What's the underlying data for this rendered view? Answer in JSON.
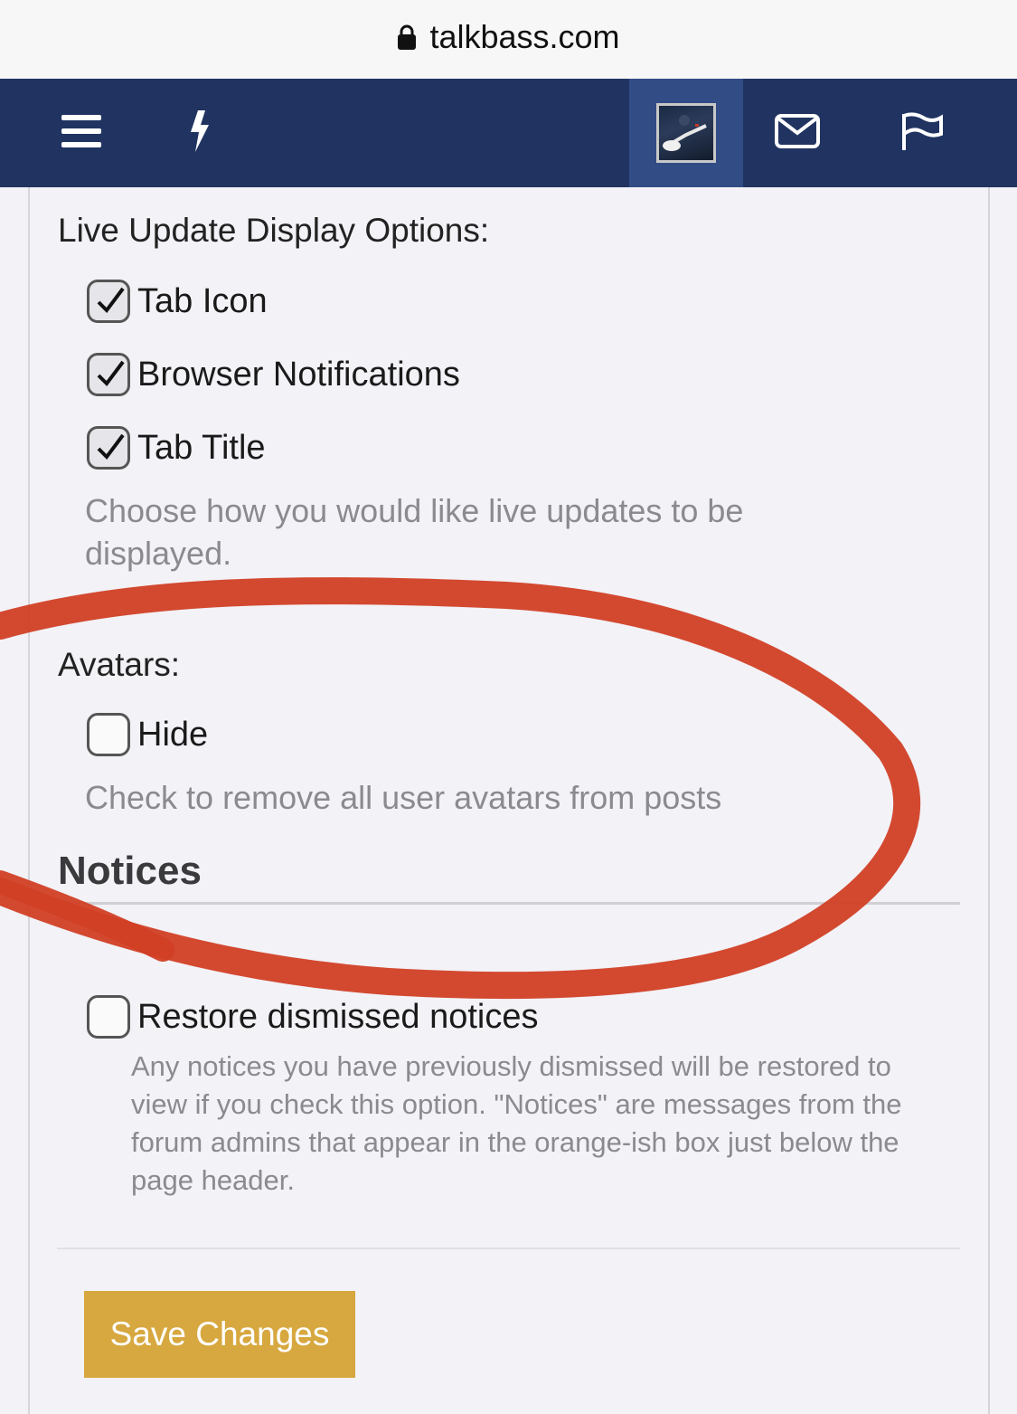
{
  "browser": {
    "url": "talkbass.com"
  },
  "header": {
    "icons": [
      "menu-icon",
      "lightning-icon",
      "avatar",
      "envelope-icon",
      "flag-icon"
    ]
  },
  "live_update": {
    "label": "Live Update Display Options:",
    "options": [
      {
        "label": "Tab Icon",
        "checked": true
      },
      {
        "label": "Browser Notifications",
        "checked": true
      },
      {
        "label": "Tab Title",
        "checked": true
      }
    ],
    "hint": "Choose how you would like live updates to be displayed."
  },
  "avatars": {
    "label": "Avatars:",
    "option_label": "Hide",
    "checked": false,
    "hint": "Check to remove all user avatars from posts"
  },
  "notices": {
    "title": "Notices",
    "option_label": "Restore dismissed notices",
    "checked": false,
    "hint": "Any notices you have previously dismissed will be restored to view if you check this option. \"Notices\" are messages from the forum admins that appear in the orange-ish box just below the page header."
  },
  "save_button": "Save Changes",
  "colors": {
    "header_bg": "#213461",
    "active_tab_bg": "#324c86",
    "save_button_bg": "#d7a83f",
    "annotation_stroke": "#d13f25"
  }
}
